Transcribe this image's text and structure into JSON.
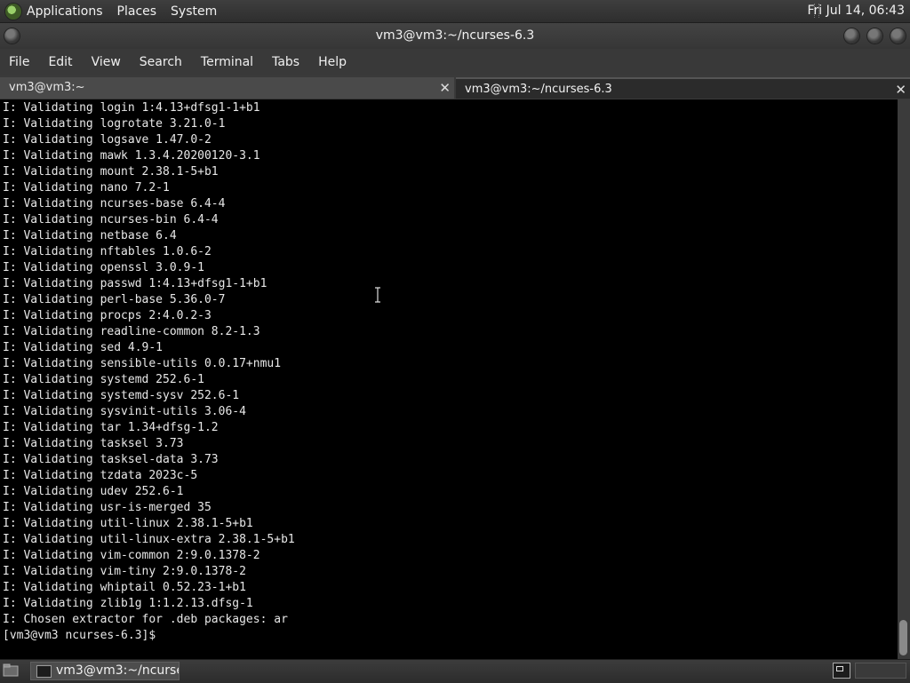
{
  "top_panel": {
    "menus": [
      "Applications",
      "Places",
      "System"
    ],
    "clock": "Fri Jul 14, 06:43"
  },
  "window": {
    "title": "vm3@vm3:~/ncurses-6.3"
  },
  "menubar": [
    "File",
    "Edit",
    "View",
    "Search",
    "Terminal",
    "Tabs",
    "Help"
  ],
  "tabs": [
    {
      "label": "vm3@vm3:~",
      "active": false
    },
    {
      "label": "vm3@vm3:~/ncurses-6.3",
      "active": true
    }
  ],
  "terminal": {
    "lines": [
      "I: Validating login 1:4.13+dfsg1-1+b1",
      "I: Validating logrotate 3.21.0-1",
      "I: Validating logsave 1.47.0-2",
      "I: Validating mawk 1.3.4.20200120-3.1",
      "I: Validating mount 2.38.1-5+b1",
      "I: Validating nano 7.2-1",
      "I: Validating ncurses-base 6.4-4",
      "I: Validating ncurses-bin 6.4-4",
      "I: Validating netbase 6.4",
      "I: Validating nftables 1.0.6-2",
      "I: Validating openssl 3.0.9-1",
      "I: Validating passwd 1:4.13+dfsg1-1+b1",
      "I: Validating perl-base 5.36.0-7",
      "I: Validating procps 2:4.0.2-3",
      "I: Validating readline-common 8.2-1.3",
      "I: Validating sed 4.9-1",
      "I: Validating sensible-utils 0.0.17+nmu1",
      "I: Validating systemd 252.6-1",
      "I: Validating systemd-sysv 252.6-1",
      "I: Validating sysvinit-utils 3.06-4",
      "I: Validating tar 1.34+dfsg-1.2",
      "I: Validating tasksel 3.73",
      "I: Validating tasksel-data 3.73",
      "I: Validating tzdata 2023c-5",
      "I: Validating udev 252.6-1",
      "I: Validating usr-is-merged 35",
      "I: Validating util-linux 2.38.1-5+b1",
      "I: Validating util-linux-extra 2.38.1-5+b1",
      "I: Validating vim-common 2:9.0.1378-2",
      "I: Validating vim-tiny 2:9.0.1378-2",
      "I: Validating whiptail 0.52.23-1+b1",
      "I: Validating zlib1g 1:1.2.13.dfsg-1",
      "I: Chosen extractor for .deb packages: ar"
    ],
    "prompt": "[vm3@vm3 ncurses-6.3]$"
  },
  "taskbar": {
    "window_button": "vm3@vm3:~/ncurse..."
  }
}
